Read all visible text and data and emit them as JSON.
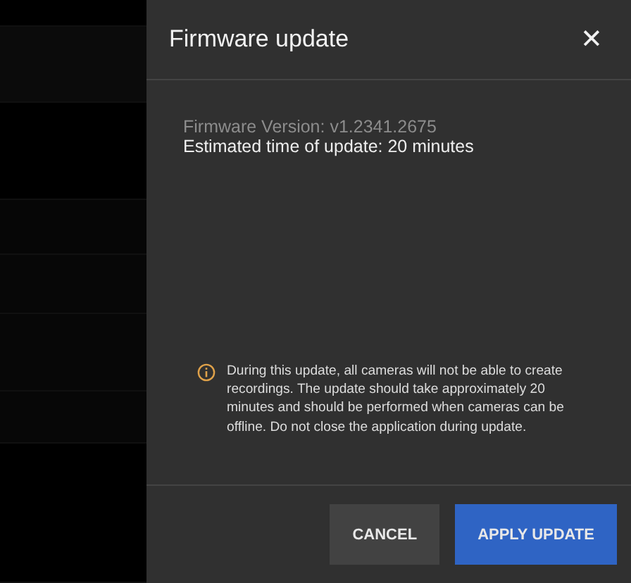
{
  "dialog": {
    "title": "Firmware update",
    "close": "✕",
    "details": [
      {
        "kind": "muted",
        "text": "Firmware Version: v1.2341.2675"
      },
      {
        "kind": "plain",
        "text": "Estimated time of update: 20 minutes"
      }
    ],
    "warning": "During this update, all cameras will not be able to create recordings. The update should take approximately 20 minutes and should be performed when cameras can be offline. Do not close the application during update.",
    "buttons": [
      {
        "kind": "secondary",
        "label": "CANCEL"
      },
      {
        "kind": "primary",
        "label": "APPLY UPDATE"
      }
    ]
  }
}
